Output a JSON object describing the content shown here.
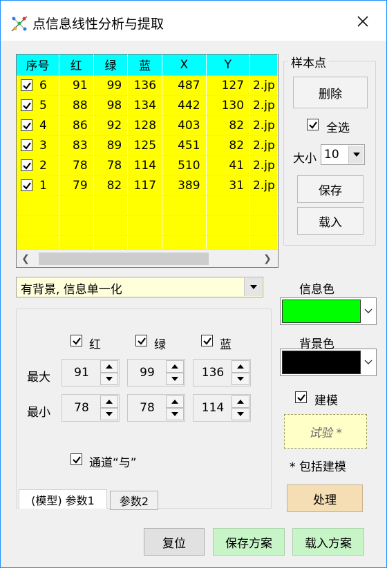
{
  "window": {
    "title": "点信息线性分析与提取",
    "border_color": "#1e90ff"
  },
  "table": {
    "headers": [
      "序号",
      "红",
      "绿",
      "蓝",
      "X",
      "Y",
      ""
    ],
    "rows": [
      {
        "idx": "6",
        "r": "91",
        "g": "99",
        "b": "136",
        "x": "487",
        "y": "127",
        "file": "2.jp"
      },
      {
        "idx": "5",
        "r": "88",
        "g": "98",
        "b": "134",
        "x": "442",
        "y": "130",
        "file": "2.jp"
      },
      {
        "idx": "4",
        "r": "86",
        "g": "92",
        "b": "128",
        "x": "403",
        "y": "82",
        "file": "2.jp"
      },
      {
        "idx": "3",
        "r": "83",
        "g": "89",
        "b": "125",
        "x": "451",
        "y": "82",
        "file": "2.jp"
      },
      {
        "idx": "2",
        "r": "78",
        "g": "78",
        "b": "114",
        "x": "510",
        "y": "41",
        "file": "2.jp"
      },
      {
        "idx": "1",
        "r": "79",
        "g": "82",
        "b": "117",
        "x": "389",
        "y": "31",
        "file": "2.jp"
      }
    ],
    "header_color": "#00ffff",
    "body_color": "#ffff00"
  },
  "samples": {
    "legend": "样本点",
    "delete_label": "删除",
    "select_all_label": "全选",
    "size_label": "大小",
    "size_value": "10",
    "save_label": "保存",
    "load_label": "载入"
  },
  "mode_select": {
    "value": "有背景, 信息单一化"
  },
  "channels": {
    "red_label": "红",
    "green_label": "绿",
    "blue_label": "蓝",
    "max_label": "最大",
    "min_label": "最小",
    "max": {
      "r": "91",
      "g": "99",
      "b": "136"
    },
    "min": {
      "r": "78",
      "g": "78",
      "b": "114"
    },
    "and_label": "通道“与”"
  },
  "tabs": {
    "tab1": "(模型) 参数1",
    "tab2": "参数2"
  },
  "colors": {
    "info_label": "信息色",
    "info_color": "#00ff00",
    "bg_label": "背景色",
    "bg_color": "#000000"
  },
  "model": {
    "label": "建模",
    "trial_label": "试验 *",
    "note": "* 包括建模",
    "process_label": "处理"
  },
  "footer": {
    "reset_label": "复位",
    "save_plan_label": "保存方案",
    "load_plan_label": "载入方案"
  }
}
